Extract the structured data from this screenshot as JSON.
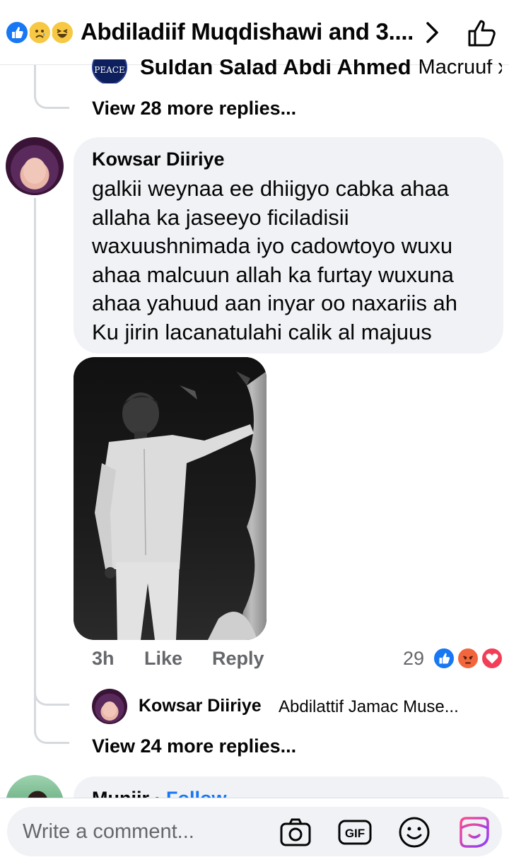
{
  "header": {
    "title": "Abdiladiif Muqdishawi and 3....",
    "reactions": [
      "like-icon",
      "sad-icon",
      "haha-icon"
    ]
  },
  "thread": {
    "partial_reply": {
      "badge_text": "PEACE",
      "name": "Suldan Salad Abdi Ahmed",
      "text": "Macruuf xa..."
    },
    "view_more_top": "View 28 more replies...",
    "comment": {
      "author": "Kowsar Diiriye",
      "text_lines": [
        "galkii weynaa ee dhiigyo cabka ahaa",
        "allaha ka jaseeyo ficiladisii",
        "waxuushnimada iyo cadowtoyo wuxu",
        "ahaa malcuun allah ka furtay wuxuna",
        "ahaa yahuud aan inyar oo naxariis ah",
        "Ku jirin lacanatulahi calik al majuus"
      ],
      "time": "3h",
      "like_label": "Like",
      "reply_label": "Reply",
      "reaction_count": "29",
      "reaction_icons": [
        "like-icon",
        "angry-icon",
        "love-icon"
      ]
    },
    "reply": {
      "author": "Kowsar Diiriye",
      "text": "Abdilattif Jamac Muse..."
    },
    "view_more_bottom": "View 24 more replies...",
    "next_comment": {
      "author": "Muniir",
      "separator": "·",
      "follow_label": "Follow"
    }
  },
  "composer": {
    "placeholder": "Write a comment...",
    "icons": [
      "camera-icon",
      "gif-icon",
      "emoji-icon",
      "avatar-sticker-icon"
    ]
  },
  "colors": {
    "accent": "#1877f2",
    "bubble": "#f0f2f5",
    "muted": "#65676b",
    "angry": "#f2663d",
    "love": "#f33e58"
  }
}
